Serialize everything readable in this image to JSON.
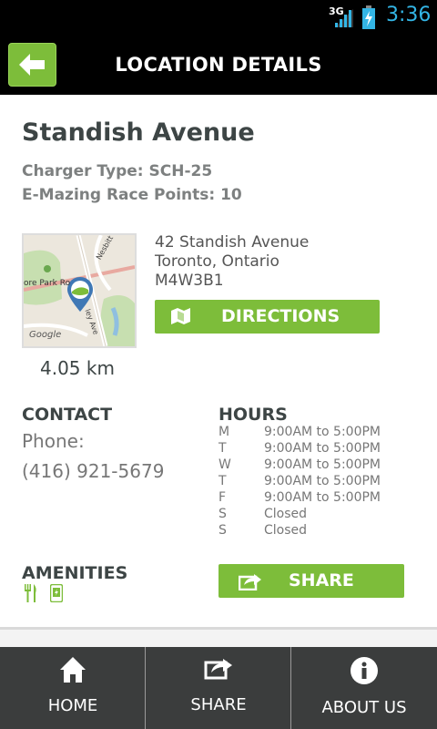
{
  "status_bar": {
    "network": "3G",
    "time": "3:36"
  },
  "header": {
    "title": "LOCATION DETAILS",
    "back_icon": "back-arrow-icon"
  },
  "location": {
    "name": "Standish Avenue",
    "charger_type": "Charger Type: SCH-25",
    "race_points": "E-Mazing Race Points: 10",
    "address_line1": "42 Standish Avenue",
    "address_line2": "Toronto, Ontario",
    "address_line3": "M4W3B1",
    "distance": "4.05 km"
  },
  "map": {
    "label_park": "ore Park Ro",
    "label_street1": "Nesbitt Dr",
    "label_street2": "ley Ave",
    "label_google": "Google"
  },
  "directions_button": {
    "label": "DIRECTIONS",
    "icon": "map-icon"
  },
  "contact": {
    "title": "CONTACT",
    "phone_label": "Phone:",
    "phone_number": "(416) 921-5679"
  },
  "hours": {
    "title": "HOURS",
    "rows": [
      {
        "day": "M",
        "time": "9:00AM to 5:00PM"
      },
      {
        "day": "T",
        "time": "9:00AM to 5:00PM"
      },
      {
        "day": "W",
        "time": "9:00AM to 5:00PM"
      },
      {
        "day": "T",
        "time": "9:00AM to 5:00PM"
      },
      {
        "day": "F",
        "time": "9:00AM to 5:00PM"
      },
      {
        "day": "S",
        "time": "Closed"
      },
      {
        "day": "S",
        "time": "Closed"
      }
    ]
  },
  "amenities": {
    "title": "AMENITIES",
    "icons": [
      "restaurant-icon",
      "phone-device-icon"
    ]
  },
  "share_button": {
    "label": "SHARE",
    "icon": "share-icon"
  },
  "bottom_nav": {
    "home": "HOME",
    "share": "SHARE",
    "about": "ABOUT US"
  },
  "colors": {
    "accent_green": "#7dbd3a",
    "header_bg": "#000000",
    "nav_bg": "#3b3d3d",
    "clock_blue": "#33b5e5"
  }
}
